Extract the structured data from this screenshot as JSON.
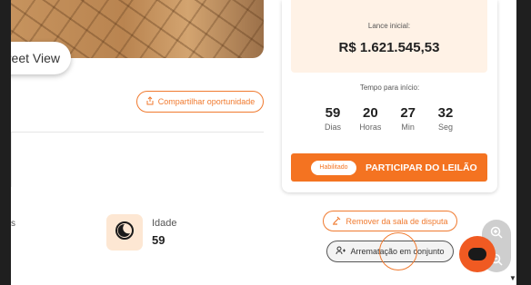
{
  "left": {
    "street_view_label": "reet View",
    "share_label": "Compartilhar oportunidade",
    "partial_label": "s",
    "age_label": "Idade",
    "age_value": "59"
  },
  "auction": {
    "bid_label": "Lance inicial:",
    "bid_value": "R$ 1.621.545,53",
    "time_label": "Tempo para início:",
    "timer": [
      {
        "value": "59",
        "unit": "Dias"
      },
      {
        "value": "20",
        "unit": "Horas"
      },
      {
        "value": "27",
        "unit": "Min"
      },
      {
        "value": "32",
        "unit": "Seg"
      }
    ],
    "badge": "Habilitado",
    "bid_button": "PARTICIPAR DO LEILÃO",
    "remove_label": "Remover da sala de disputa",
    "joint_label": "Arrematação em conjunto"
  },
  "colors": {
    "accent": "#f47321",
    "bid_bg": "#fff2e6"
  },
  "icons": [
    "share-icon",
    "moon-clock-icon",
    "remove-icon",
    "group-icon",
    "zoom-in-icon",
    "zoom-out-icon",
    "chat-fab-icon"
  ]
}
